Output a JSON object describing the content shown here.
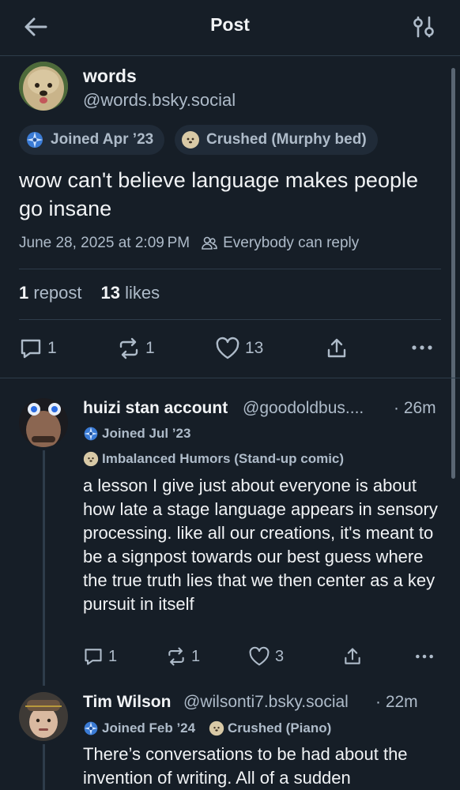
{
  "header": {
    "title": "Post"
  },
  "post": {
    "name": "words",
    "handle": "@words.bsky.social",
    "badges": [
      "Joined Apr ’23",
      "Crushed (Murphy bed)"
    ],
    "text": "wow can't believe language makes people go insane",
    "timestamp": "June 28, 2025 at 2:09 PM",
    "reply_setting": "Everybody can reply",
    "repost_count": "1",
    "repost_label": "repost",
    "like_count": "13",
    "like_label": "likes",
    "actions": {
      "replies": "1",
      "reposts": "1",
      "likes": "13"
    }
  },
  "replies": [
    {
      "name": "huizi stan account",
      "handle": "@goodoldbus....",
      "time": "· 26m",
      "badges": [
        "Joined Jul ’23",
        "Imbalanced Humors (Stand-up comic)"
      ],
      "text": "a lesson I give just about everyone is about how late a stage language appears in sensory processing. like all our creations, it's meant to be a signpost towards our best guess where the true truth lies that we then center as a key pursuit in itself",
      "actions": {
        "replies": "1",
        "reposts": "1",
        "likes": "3"
      }
    },
    {
      "name": "Tim Wilson",
      "handle": "@wilsonti7.bsky.social",
      "time": "· 22m",
      "badges": [
        "Joined Feb ’24",
        "Crushed (Piano)"
      ],
      "text": "There’s conversations to be had about the invention of writing. All of a sudden"
    }
  ],
  "colors": {
    "background": "#161e27",
    "muted": "#aebbc9",
    "divider": "#2e3c4a",
    "badge_bg": "#202b38"
  }
}
